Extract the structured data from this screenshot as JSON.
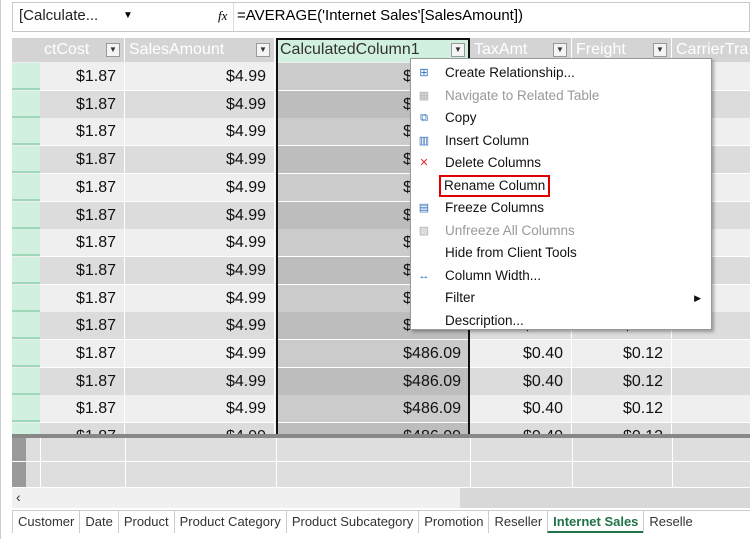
{
  "formula_bar": {
    "name_box": "[Calculate...",
    "dropdown_icon": "caret-down-icon",
    "fx_label": "fx",
    "formula": "=AVERAGE('Internet Sales'[SalesAmount])"
  },
  "columns": [
    "ctCost",
    "SalesAmount",
    "CalculatedColumn1",
    "TaxAmt",
    "Freight",
    "CarrierTra"
  ],
  "selected_column": "CalculatedColumn1",
  "rows": [
    [
      "$1.87",
      "$4.99",
      "$486.09",
      "$0.40",
      "$0.12",
      ""
    ],
    [
      "$1.87",
      "$4.99",
      "$486.09",
      "$0.40",
      "$0.12",
      ""
    ],
    [
      "$1.87",
      "$4.99",
      "$486.09",
      "$0.40",
      "$0.12",
      ""
    ],
    [
      "$1.87",
      "$4.99",
      "$486.09",
      "$0.40",
      "$0.12",
      ""
    ],
    [
      "$1.87",
      "$4.99",
      "$486.09",
      "$0.40",
      "$0.12",
      ""
    ],
    [
      "$1.87",
      "$4.99",
      "$486.09",
      "$0.40",
      "$0.12",
      ""
    ],
    [
      "$1.87",
      "$4.99",
      "$486.09",
      "$0.40",
      "$0.12",
      ""
    ],
    [
      "$1.87",
      "$4.99",
      "$486.09",
      "$0.40",
      "$0.12",
      ""
    ],
    [
      "$1.87",
      "$4.99",
      "$486.09",
      "$0.40",
      "$0.12",
      ""
    ],
    [
      "$1.87",
      "$4.99",
      "$486.09",
      "$0.40",
      "$0.12",
      ""
    ],
    [
      "$1.87",
      "$4.99",
      "$486.09",
      "$0.40",
      "$0.12",
      ""
    ],
    [
      "$1.87",
      "$4.99",
      "$486.09",
      "$0.40",
      "$0.12",
      ""
    ],
    [
      "$1.87",
      "$4.99",
      "$486.09",
      "$0.40",
      "$0.12",
      ""
    ],
    [
      "$1.87",
      "$4.99",
      "$486.09",
      "$0.40",
      "$0.12",
      ""
    ]
  ],
  "context_menu": [
    {
      "label": "Create Relationship...",
      "icon": "relationship-icon",
      "enabled": true
    },
    {
      "label": "Navigate to Related Table",
      "icon": "table-icon",
      "enabled": false
    },
    {
      "label": "Copy",
      "icon": "copy-icon",
      "enabled": true
    },
    {
      "label": "Insert Column",
      "icon": "insert-column-icon",
      "enabled": true
    },
    {
      "label": "Delete Columns",
      "icon": "delete-column-icon",
      "enabled": true
    },
    {
      "label": "Rename Column",
      "icon": "",
      "enabled": true,
      "highlighted": true
    },
    {
      "label": "Freeze Columns",
      "icon": "freeze-icon",
      "enabled": true
    },
    {
      "label": "Unfreeze All Columns",
      "icon": "unfreeze-icon",
      "enabled": false
    },
    {
      "label": "Hide from Client Tools",
      "icon": "",
      "enabled": true
    },
    {
      "label": "Column Width...",
      "icon": "column-width-icon",
      "enabled": true
    },
    {
      "label": "Filter",
      "icon": "",
      "enabled": true,
      "submenu": true
    },
    {
      "label": "Description...",
      "icon": "",
      "enabled": true
    }
  ],
  "sheet_tabs": [
    "Customer",
    "Date",
    "Product",
    "Product Category",
    "Product Subcategory",
    "Promotion",
    "Reseller",
    "Internet Sales",
    "Reselle"
  ],
  "active_tab": "Internet Sales",
  "colors": {
    "accent": "#217346",
    "highlight_box": "#e00000",
    "row_header": "#d2f0df"
  }
}
